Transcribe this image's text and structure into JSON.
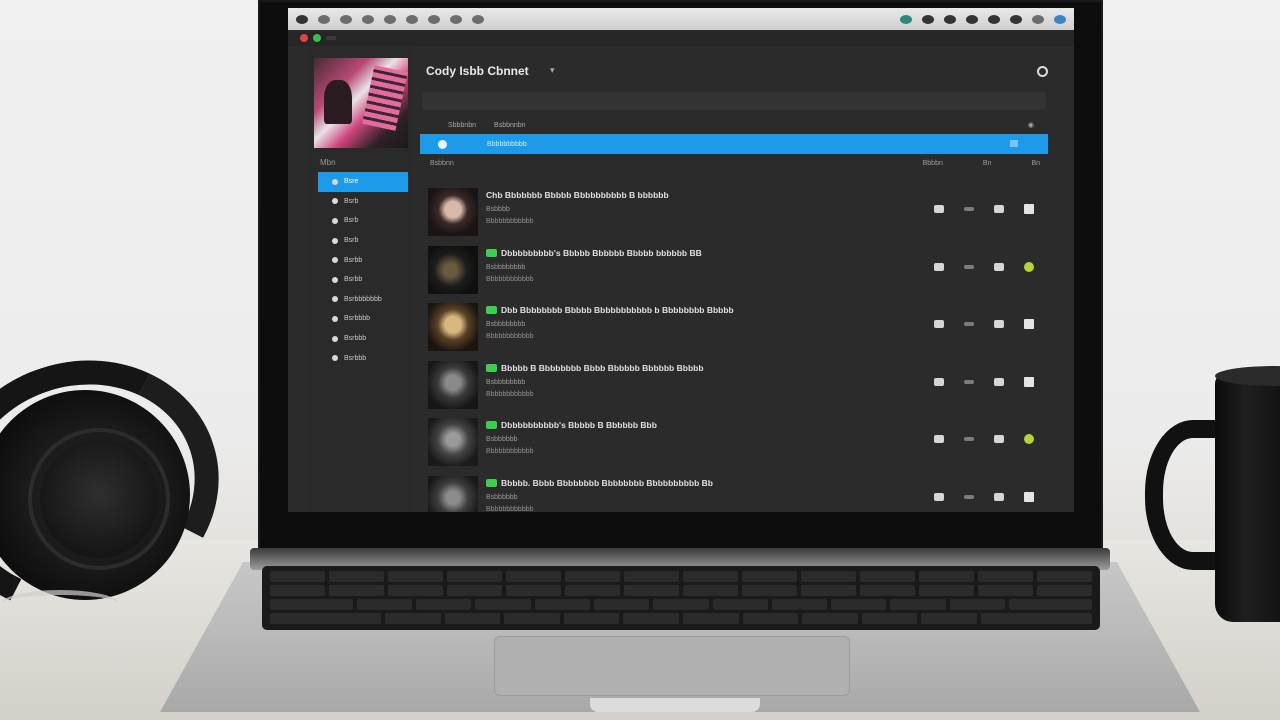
{
  "app": {
    "title": "Cody Isbb Cbnnet",
    "title_chevron": "▾"
  },
  "sidebar": {
    "heading": "Mbn",
    "items": [
      {
        "label": "Bsre",
        "active": true
      },
      {
        "label": "Bsrb"
      },
      {
        "label": "Bsrb"
      },
      {
        "label": "Bsrb"
      },
      {
        "label": "Bsrbb"
      },
      {
        "label": "Bsrbb"
      },
      {
        "label": "Bsrbbbbbbb"
      },
      {
        "label": "Bsrbbbb"
      },
      {
        "label": "Bsrbbb"
      },
      {
        "label": "Bsrbbb"
      }
    ]
  },
  "header": {
    "col_left": "Sbbbnbn",
    "col_mid": "Bsbbnnbn",
    "col_right": "◉"
  },
  "now_playing": {
    "label": "Bbbbbbbbbb"
  },
  "sub_header": {
    "left": "Bsbbnn",
    "mid": "Bbbbn",
    "right1": "Bn",
    "right2": "Bn"
  },
  "tracks": [
    {
      "title": "Chb Bbbbbbb Bbbbb Bbbbbbbbbb B bbbbbb",
      "sub1": "Bsbbbb",
      "sub2": "Bbbbbbbbbbbb",
      "badge": false,
      "end_color": "white"
    },
    {
      "title": "Dbbbbbbbbb's Bbbbb Bbbbbb Bbbbb bbbbbb BB",
      "sub1": "Bsbbbbbbbb",
      "sub2": "Bbbbbbbbbbbb",
      "badge": true,
      "end_color": "green"
    },
    {
      "title": "Dbb Bbbbbbbb Bbbbb Bbbbbbbbbbb b Bbbbbbbb Bbbbb",
      "sub1": "Bsbbbbbbbb",
      "sub2": "Bbbbbbbbbbbb",
      "badge": true,
      "end_color": "white"
    },
    {
      "title": "Bbbbb B Bbbbbbbb Bbbb Bbbbbb Bbbbbb Bbbbb",
      "sub1": "Bsbbbbbbbb",
      "sub2": "Bbbbbbbbbbbb",
      "badge": true,
      "end_color": "white"
    },
    {
      "title": "Dbbbbbbbbbb's Bbbbb B Bbbbbb Bbb",
      "sub1": "Bsbbbbbb",
      "sub2": "Bbbbbbbbbbbb",
      "badge": true,
      "end_color": "green"
    },
    {
      "title": "Bbbbb. Bbbb Bbbbbbbb Bbbbbbbb Bbbbbbbbbb Bb",
      "sub1": "Bsbbbbbb",
      "sub2": "Bbbbbbbbbbbb",
      "badge": true,
      "end_color": "white"
    }
  ]
}
